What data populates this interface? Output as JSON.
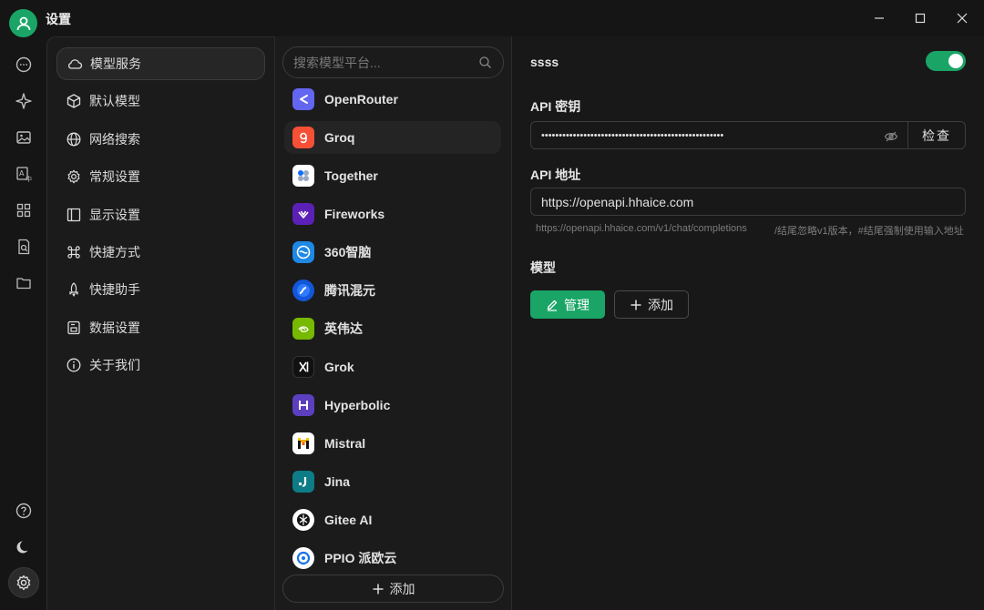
{
  "window": {
    "title": "设置",
    "minimize_icon": "minimize-icon",
    "maximize_icon": "maximize-icon",
    "close_icon": "close-icon"
  },
  "colors": {
    "accent": "#1aa566",
    "bg": "#151515",
    "panel": "#1b1b1b",
    "border": "#3c3c3c"
  },
  "rail": {
    "top_icons": [
      "chat-icon",
      "sparkle-icon",
      "image-icon",
      "translate-icon",
      "apps-icon",
      "document-search-icon",
      "folder-icon"
    ],
    "bottom_icons": [
      "help-icon",
      "theme-moon-icon",
      "settings-gear-icon"
    ]
  },
  "nav": {
    "items": [
      {
        "label": "模型服务",
        "icon": "cloud-icon"
      },
      {
        "label": "默认模型",
        "icon": "cube-icon"
      },
      {
        "label": "网络搜索",
        "icon": "globe-icon"
      },
      {
        "label": "常规设置",
        "icon": "gear-icon"
      },
      {
        "label": "显示设置",
        "icon": "layout-icon"
      },
      {
        "label": "快捷方式",
        "icon": "command-icon"
      },
      {
        "label": "快捷助手",
        "icon": "rocket-icon"
      },
      {
        "label": "数据设置",
        "icon": "database-icon"
      },
      {
        "label": "关于我们",
        "icon": "info-icon"
      }
    ]
  },
  "providers": {
    "search_placeholder": "搜索模型平台...",
    "items": [
      {
        "name": "OpenRouter",
        "logo_color": "#6366f1",
        "glyph": "<"
      },
      {
        "name": "Groq",
        "logo_color": "#f55036",
        "glyph": "g"
      },
      {
        "name": "Together",
        "logo_color": "#ffffff",
        "glyph": ""
      },
      {
        "name": "Fireworks",
        "logo_color": "#5b21b6",
        "glyph": ""
      },
      {
        "name": "360智脑",
        "logo_color": "#1e88e5",
        "glyph": ""
      },
      {
        "name": "腾讯混元",
        "logo_color": "#1456d8",
        "glyph": ""
      },
      {
        "name": "英伟达",
        "logo_color": "#76b900",
        "glyph": ""
      },
      {
        "name": "Grok",
        "logo_color": "#111111",
        "glyph": "x"
      },
      {
        "name": "Hyperbolic",
        "logo_color": "#5b3fbf",
        "glyph": "H"
      },
      {
        "name": "Mistral",
        "logo_color": "#ffffff",
        "glyph": "M"
      },
      {
        "name": "Jina",
        "logo_color": "#0e7c86",
        "glyph": "J"
      },
      {
        "name": "Gitee AI",
        "logo_color": "#ffffff",
        "glyph": ""
      },
      {
        "name": "PPIO 派欧云",
        "logo_color": "#ffffff",
        "glyph": ""
      }
    ],
    "add_label": "添加"
  },
  "detail": {
    "provider_name": "ssss",
    "enabled": true,
    "api_key_label": "API 密钥",
    "api_key_value": "••••••••••••••••••••••••••••••••••••••••••••••••••••",
    "check_label": "检查",
    "api_host_label": "API 地址",
    "api_host_value": "https://openapi.hhaice.com",
    "hint_preview": "https://openapi.hhaice.com/v1/chat/completions",
    "hint_rules": "/结尾忽略v1版本，#结尾强制使用输入地址",
    "models_label": "模型",
    "manage_label": "管理",
    "add_label": "添加"
  }
}
